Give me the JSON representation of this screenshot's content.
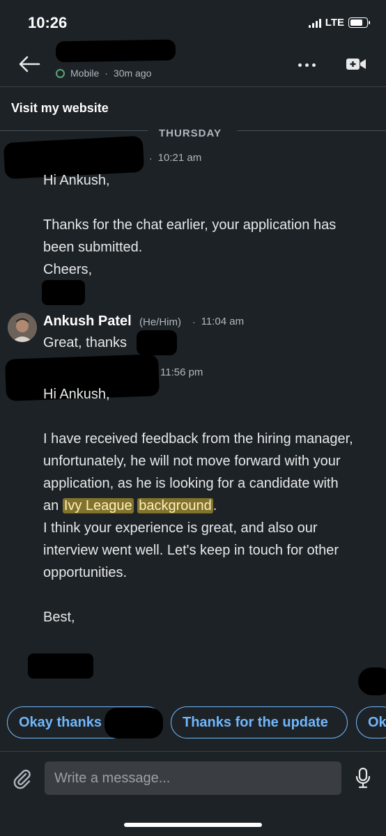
{
  "status_bar": {
    "time": "10:26",
    "network": "LTE"
  },
  "header": {
    "presence_text": "Mobile",
    "last_active": "30m ago"
  },
  "banner": {
    "link_text": "Visit my website"
  },
  "thread": {
    "day_label": "THURSDAY",
    "messages": [
      {
        "time": "10:21 am",
        "lines": [
          "Hi Ankush,",
          "",
          "Thanks for the chat earlier, your application has been submitted.",
          "Cheers,"
        ]
      },
      {
        "sender": "Ankush Patel",
        "pronouns": "(He/Him)",
        "time": "11:04 am",
        "text": "Great, thanks"
      },
      {
        "time": "11:56 pm",
        "greeting": "Hi Ankush,",
        "body_before": "I have received feedback from the hiring manager, unfortunately, he will not move forward with your application, as he is looking for a candidate with an",
        "highlight_1": "Ivy League",
        "highlight_2": "background",
        "body_after_period": ".",
        "body_2": "I think your experience is great, and also our interview went well. Let's keep in touch for other opportunities.",
        "closing": "Best,"
      }
    ]
  },
  "smart_replies": [
    "Okay thanks",
    "Thanks for the update",
    "Ok"
  ],
  "composer": {
    "placeholder": "Write a message..."
  },
  "colors": {
    "background": "#1d2226",
    "accent": "#71b7fb",
    "highlight": "#c4aa2f",
    "online": "#57a773"
  },
  "icons": [
    "back-arrow-icon",
    "more-icon",
    "video-call-icon",
    "paperclip-icon",
    "microphone-icon"
  ]
}
